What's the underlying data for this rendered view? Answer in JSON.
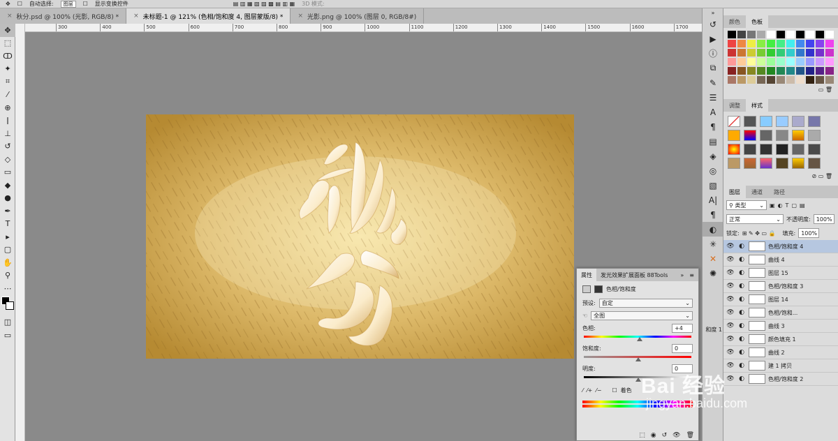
{
  "options_bar": {
    "auto_select_label": "自动选择:",
    "auto_select_value": "图层",
    "show_transform_label": "显示变换控件",
    "mode_3d": "3D 模式:"
  },
  "doc_tabs": [
    {
      "label": "秋分.psd @ 100% (光影, RGB/8) *"
    },
    {
      "label": "未标题-1 @ 121% (色相/饱和度 4, 图层蒙版/8) *"
    },
    {
      "label": "光影.png @ 100% (图层 0, RGB/8#)"
    }
  ],
  "tab_close": "×",
  "ruler_ticks": [
    "300",
    "400",
    "500",
    "600",
    "700",
    "800",
    "900",
    "1000",
    "1100",
    "1200",
    "1300",
    "1400",
    "1500",
    "1600",
    "1700"
  ],
  "swatches_panel": {
    "tabs": [
      "颜色",
      "色板"
    ]
  },
  "adjust_panel": {
    "tabs": [
      "调整",
      "样式"
    ]
  },
  "layers_panel": {
    "tabs": [
      "图层",
      "通道",
      "路径"
    ],
    "filter_type": "类型",
    "blend_mode": "正常",
    "opacity_label": "不透明度:",
    "opacity_value": "100%",
    "lock_label": "锁定:",
    "fill_label": "填充:",
    "fill_value": "100%",
    "layers": [
      {
        "name": "色相/饱和度 4",
        "selected": true
      },
      {
        "name": "曲线 4"
      },
      {
        "name": "图层 15"
      },
      {
        "name": "色相/饱和度 3"
      },
      {
        "name": "图层 14"
      },
      {
        "name": "色相/饱和..."
      },
      {
        "name": "曲线 3"
      },
      {
        "name": "颜色填充 1"
      },
      {
        "name": "曲线 2"
      },
      {
        "name": "建 1 拷贝"
      },
      {
        "name": "色相/饱和度 2"
      }
    ]
  },
  "properties": {
    "tabs": [
      "属性",
      "发光效果扩展面板 88Tools"
    ],
    "tabs_more": "»",
    "title": "色相/饱和度",
    "preset_label": "预设:",
    "preset_value": "自定",
    "channel_value": "全图",
    "hue_label": "色相:",
    "hue_value": "+4",
    "hue_pct": 0.51,
    "saturation_label": "饱和度:",
    "saturation_value": "0",
    "saturation_pct": 0.5,
    "lightness_label": "明度:",
    "lightness_value": "0",
    "lightness_pct": 0.5,
    "colorize_label": "着色"
  },
  "midstrip_label": "和度 1",
  "artwork": {
    "text": "秋分"
  },
  "watermark": {
    "brand": "Bai 经验",
    "domain": "jingyan.baidu.com"
  },
  "colors": {
    "canvas_bg": "#8a8a8a",
    "art_light": "#f4dc94",
    "art_dark": "#b88a30",
    "cream": "#fff4dc",
    "selection": "#b6c7e0"
  }
}
